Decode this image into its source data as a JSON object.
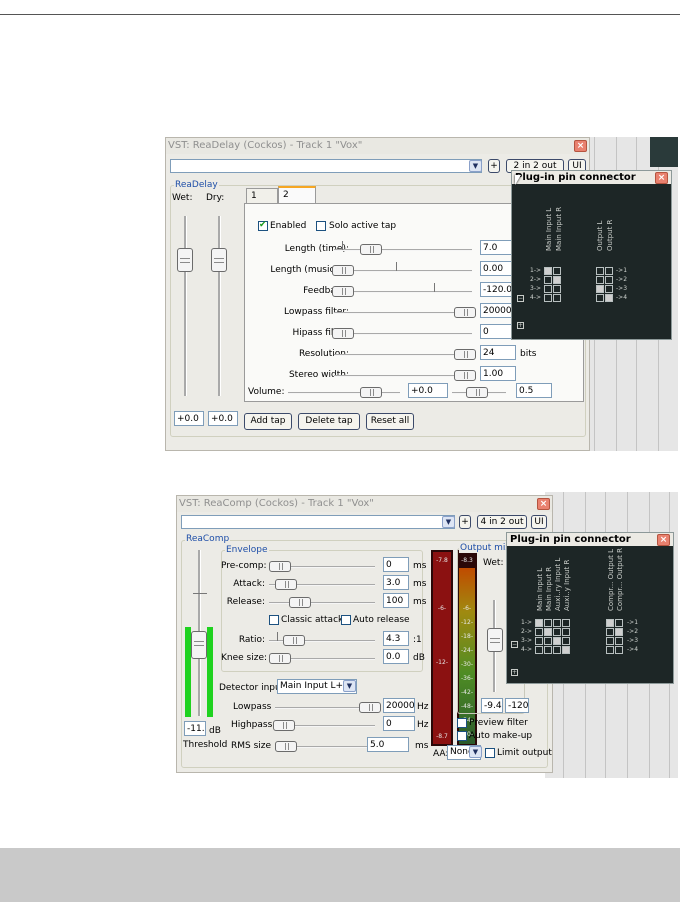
{
  "delay": {
    "title": "VST: ReaDelay (Cockos) - Track 1 \"Vox\"",
    "plus": "+",
    "io_button": "2 in 2 out",
    "ui_button": "UI",
    "group_label": "ReaDelay",
    "wet_label": "Wet:",
    "dry_label": "Dry:",
    "wet_value": "+0.0",
    "dry_value": "+0.0",
    "tabs": [
      "1",
      "2"
    ],
    "enabled_label": "Enabled",
    "solo_label": "Solo active tap",
    "rows": [
      {
        "label": "Length (time):",
        "value": "7.0",
        "unit": ""
      },
      {
        "label": "Length (musical):",
        "value": "0.00",
        "unit": ""
      },
      {
        "label": "Feedback:",
        "value": "-120.0",
        "unit": ""
      },
      {
        "label": "Lowpass filter:",
        "value": "20000",
        "unit": ""
      },
      {
        "label": "Hipass filter:",
        "value": "0",
        "unit": ""
      },
      {
        "label": "Resolution:",
        "value": "24",
        "unit": "bits"
      },
      {
        "label": "Stereo width:",
        "value": "1.00",
        "unit": ""
      }
    ],
    "volume_label": "Volume:",
    "volume_value": "+0.0",
    "pan_value": "0.5",
    "add_tap": "Add tap",
    "delete_tap": "Delete tap",
    "reset_all": "Reset all"
  },
  "delay_pins": {
    "title": "Plug-in pin connector",
    "inputs": [
      "Main Input L",
      "Main Input R"
    ],
    "outputs": [
      "Output L",
      "Output R"
    ],
    "rows_in": [
      "1->",
      "2->",
      "3->",
      "4->"
    ],
    "rows_out": [
      "->1",
      "->2",
      "->3",
      "->4"
    ],
    "in_grid": [
      [
        1,
        0
      ],
      [
        0,
        1
      ],
      [
        0,
        0
      ],
      [
        0,
        0
      ]
    ],
    "out_grid": [
      [
        0,
        0
      ],
      [
        0,
        0
      ],
      [
        1,
        0
      ],
      [
        0,
        1
      ]
    ]
  },
  "comp": {
    "title": "VST: ReaComp (Cockos) - Track 1 \"Vox\"",
    "plus": "+",
    "io_button": "4 in 2 out",
    "ui_button": "UI",
    "group_label": "ReaComp",
    "envelope_label": "Envelope",
    "env_rows": [
      {
        "label": "Pre-comp:",
        "value": "0",
        "unit": "ms"
      },
      {
        "label": "Attack:",
        "value": "3.0",
        "unit": "ms"
      },
      {
        "label": "Release:",
        "value": "100",
        "unit": "ms"
      }
    ],
    "classic_attack": "Classic attack",
    "auto_release": "Auto release",
    "ratio_label": "Ratio:",
    "ratio_value": "4.3",
    "ratio_unit": ":1",
    "knee_label": "Knee size:",
    "knee_value": "0.0",
    "knee_unit": "dB",
    "detector_label": "Detector input:",
    "detector_value": "Main Input L+R",
    "filter_rows": [
      {
        "label": "Lowpass",
        "value": "20000",
        "unit": "Hz"
      },
      {
        "label": "Highpass",
        "value": "0",
        "unit": "Hz"
      },
      {
        "label": "RMS size",
        "value": "5.0",
        "unit": "ms"
      }
    ],
    "threshold_value": "-11.2",
    "threshold_unit": "dB",
    "threshold_label": "Threshold",
    "meter_left_top": "-7.8",
    "meter_left_mid": "-6-",
    "meter_left_low": "-12-",
    "meter_left_bottom": "-8.7",
    "meter_right_top": "-8.3",
    "meter_right_ticks": [
      "-6-",
      "-12-",
      "-18-",
      "-24-",
      "-30-",
      "-36-",
      "-42-",
      "-48-",
      "-54-",
      "-60-"
    ],
    "output_mix_label": "Output mix",
    "wet_label": "Wet:",
    "wet_value": "-9.4",
    "dry_value": "-120.",
    "preview_filter": "Preview filter",
    "auto_makeup": "Auto make-up",
    "aa_label": "AA:",
    "aa_value": "None",
    "limit_output": "Limit output"
  },
  "comp_pins": {
    "title": "Plug-in pin connector",
    "inputs": [
      "Main Input L",
      "Main Input R",
      "Auxi..ry Input L",
      "Auxi..y Input R"
    ],
    "outputs": [
      "Compr... Output L",
      "Compr... Output R"
    ],
    "rows_in": [
      "1->",
      "2->",
      "3->",
      "4->"
    ],
    "rows_out": [
      "->1",
      "->2",
      "->3",
      "->4"
    ],
    "in_grid": [
      [
        1,
        0,
        0,
        0
      ],
      [
        0,
        1,
        0,
        0
      ],
      [
        0,
        0,
        1,
        0
      ],
      [
        0,
        0,
        0,
        1
      ]
    ],
    "out_grid": [
      [
        1,
        0
      ],
      [
        0,
        1
      ],
      [
        0,
        0
      ],
      [
        0,
        0
      ]
    ]
  }
}
